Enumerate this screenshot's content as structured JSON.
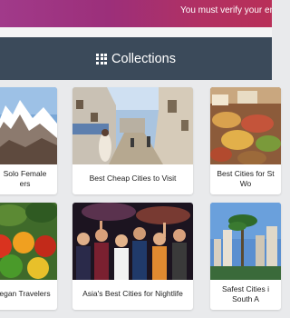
{
  "banner": {
    "text": "You must verify your email ad"
  },
  "collections": {
    "title": "Collections"
  },
  "cards": [
    {
      "caption_line1": "Solo Female",
      "caption_line2": "ers"
    },
    {
      "caption_line1": "Best Cheap Cities to Visit",
      "caption_line2": ""
    },
    {
      "caption_line1": "Best Cities for St",
      "caption_line2": "Wo"
    },
    {
      "caption_line1": "egan Travelers",
      "caption_line2": ""
    },
    {
      "caption_line1": "Asia's Best Cities for Nightlife",
      "caption_line2": ""
    },
    {
      "caption_line1": "Safest Cities i",
      "caption_line2": "South A"
    }
  ]
}
